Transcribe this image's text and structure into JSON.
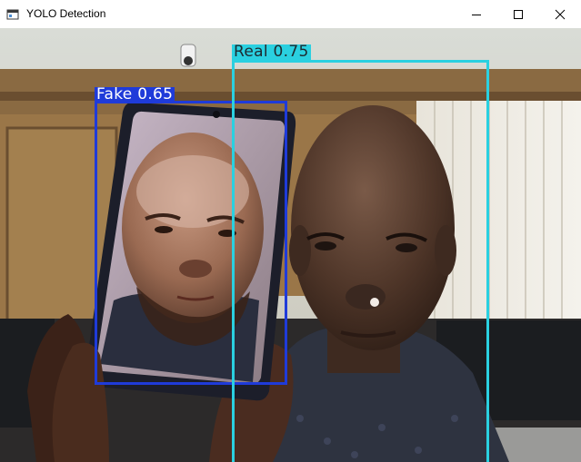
{
  "window": {
    "title": "YOLO Detection",
    "icon": "app-window-icon",
    "controls": [
      "minimize-icon",
      "maximize-icon",
      "close-icon"
    ]
  },
  "detections": [
    {
      "label": "Fake 0.65",
      "class": "Fake",
      "confidence": 0.65,
      "color": "#1f3bd9"
    },
    {
      "label": "Real 0.75",
      "class": "Real",
      "confidence": 0.75,
      "color": "#2ad0e0"
    }
  ]
}
